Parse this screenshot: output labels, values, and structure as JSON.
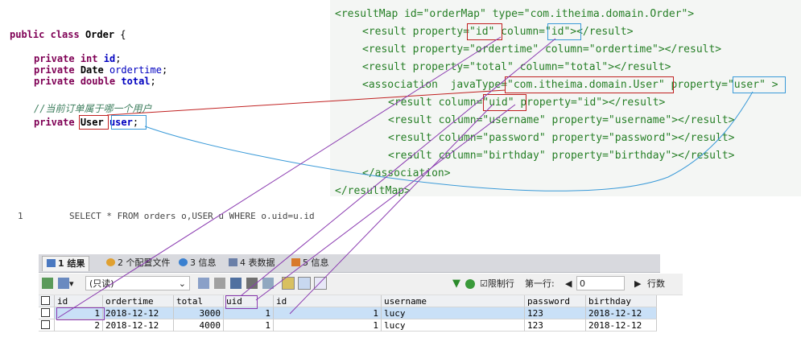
{
  "java": {
    "line1": "public class Order {",
    "line2_type": "int",
    "line2_name": "id",
    "line3_type": "Date",
    "line3_name": "ordertime",
    "line4_type": "double",
    "line4_name": "total",
    "comment": "//当前订单属于哪一个用户",
    "line6_type": "User",
    "line6_name": "user",
    "kw_public": "public",
    "kw_class": "class",
    "kw_private": "private",
    "cls": "Order"
  },
  "xml": {
    "l1": "<resultMap id=\"orderMap\" type=\"com.itheima.domain.Order\">",
    "l2": "<result property=\"id\" column=\"id\"></result>",
    "l3": "<result property=\"ordertime\" column=\"ordertime\"></result>",
    "l4": "<result property=\"total\" column=\"total\"></result>",
    "l5": "<association  javaType=\"com.itheima.domain.User\" property=\"user\" >",
    "l6": "<result column=\"uid\" property=\"id\"></result>",
    "l7": "<result column=\"username\" property=\"username\"></result>",
    "l8": "<result column=\"password\" property=\"password\"></result>",
    "l9": "<result column=\"birthday\" property=\"birthday\"></result>",
    "l10": "</association>",
    "l11": "</resultMap>"
  },
  "sql": {
    "linenum": "1",
    "query": "SELECT * FROM orders o,USER u WHERE o.uid=u.id"
  },
  "tabs": [
    {
      "label": "1 结果"
    },
    {
      "label": "2 个配置文件"
    },
    {
      "label": "3 信息"
    },
    {
      "label": "4 表数据"
    },
    {
      "label": "5 信息"
    }
  ],
  "toolbar": {
    "readonly": "(只读)",
    "limit_label": "☑限制行",
    "first_row_label": "第一行:",
    "first_row_value": "0",
    "rows_label": "行数"
  },
  "table": {
    "columns": [
      "id",
      "ordertime",
      "total",
      "uid",
      "id",
      "username",
      "password",
      "birthday"
    ],
    "rows": [
      [
        "1",
        "2018-12-12",
        "3000",
        "1",
        "1",
        "lucy",
        "123",
        "2018-12-12"
      ],
      [
        "2",
        "2018-12-12",
        "4000",
        "1",
        "1",
        "lucy",
        "123",
        "2018-12-12"
      ]
    ]
  },
  "colors": {
    "red_box": "#c02020",
    "blue_box": "#3a9ad8",
    "purple_box": "#8a3ab0",
    "selected_row": "#c9e0f7"
  }
}
